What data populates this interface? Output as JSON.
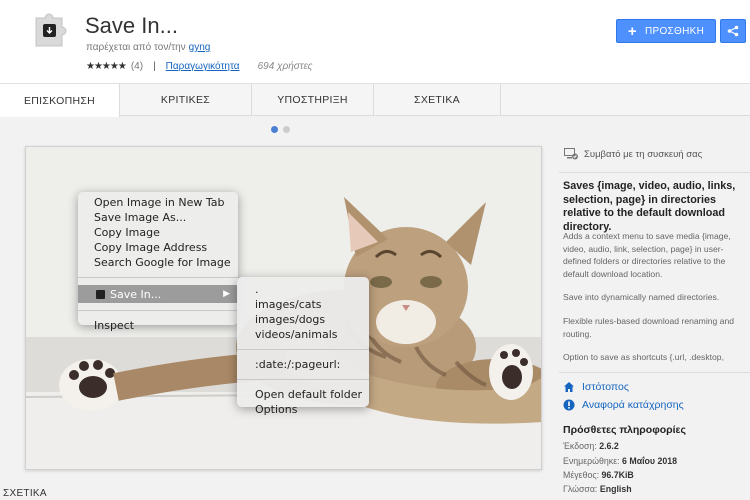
{
  "header": {
    "title": "Save In...",
    "offered_by_label": "παρέχεται από τον/την",
    "author": "gyng",
    "rating_stars": "★★★★★",
    "rating_count": "(4)",
    "category": "Παραγωγικότητα",
    "users": "694 χρήστες",
    "add_button": "ΠΡΟΣΘΗΚΗ",
    "accent_color": "#4d90fe"
  },
  "tabs": [
    {
      "label": "ΕΠΙΣΚΟΠΗΣΗ",
      "active": true
    },
    {
      "label": "ΚΡΙΤΙΚΕΣ",
      "active": false
    },
    {
      "label": "ΥΠΟΣΤΗΡΙΞΗ",
      "active": false
    },
    {
      "label": "ΣΧΕΤΙΚΑ",
      "active": false
    }
  ],
  "context_menu": {
    "items": [
      "Open Image in New Tab",
      "Save Image As...",
      "Copy Image",
      "Copy Image Address",
      "Search Google for Image"
    ],
    "save_in": "Save In...",
    "inspect": "Inspect"
  },
  "submenu": {
    "items": [
      ".",
      "images/cats",
      "images/dogs",
      "videos/animals"
    ],
    "pattern": ":date:/:pageurl:",
    "actions": [
      "Open default folder",
      "Options"
    ]
  },
  "sidebar": {
    "compat": "Συμβατό με τη συσκευή σας",
    "summary": "Saves {image, video, audio, links, selection, page} in directories relative to the default download directory.",
    "desc1": "Adds a context menu to save media {image, video, audio, link, selection, page} in user-defined folders or directories relative to the default download location.",
    "desc2": "Save into dynamically named directories.",
    "desc3": "Flexible rules-based download renaming and routing.",
    "desc4": "Option to save as shortcuts {.url, .desktop,",
    "website": "Ιστότοπος",
    "report": "Αναφορά κατάχρησης",
    "more_info_title": "Πρόσθετες πληροφορίες",
    "version_label": "Έκδοση:",
    "version": "2.6.2",
    "updated_label": "Ενημερώθηκε:",
    "updated": "6 Μαΐου 2018",
    "size_label": "Μέγεθος:",
    "size": "96.7KiB",
    "lang_label": "Γλώσσα:",
    "lang": "English"
  },
  "related_label": "ΣΧΕΤΙΚΑ"
}
